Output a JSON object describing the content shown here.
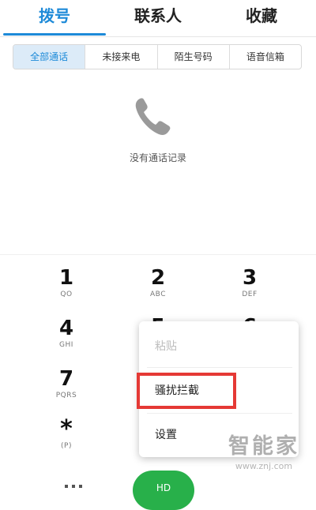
{
  "tabs": [
    "拨号",
    "联系人",
    "收藏"
  ],
  "filters": [
    "全部通话",
    "未接来电",
    "陌生号码",
    "语音信箱"
  ],
  "empty_text": "没有通话记录",
  "keypad": [
    {
      "num": "1",
      "sub": "QO"
    },
    {
      "num": "2",
      "sub": "ABC"
    },
    {
      "num": "3",
      "sub": "DEF"
    },
    {
      "num": "4",
      "sub": "GHI"
    },
    {
      "num": "5",
      "sub": ""
    },
    {
      "num": "6",
      "sub": ""
    },
    {
      "num": "7",
      "sub": "PQRS"
    },
    {
      "num": "*",
      "sub": "(P)"
    }
  ],
  "menu": [
    "粘贴",
    "骚扰拦截",
    "设置"
  ],
  "call_label": "HD",
  "watermark": {
    "text": "智能家",
    "url": "www.znj.com"
  },
  "colors": {
    "accent": "#1d8ad8",
    "highlight": "#e53935",
    "call": "#28b04a"
  }
}
